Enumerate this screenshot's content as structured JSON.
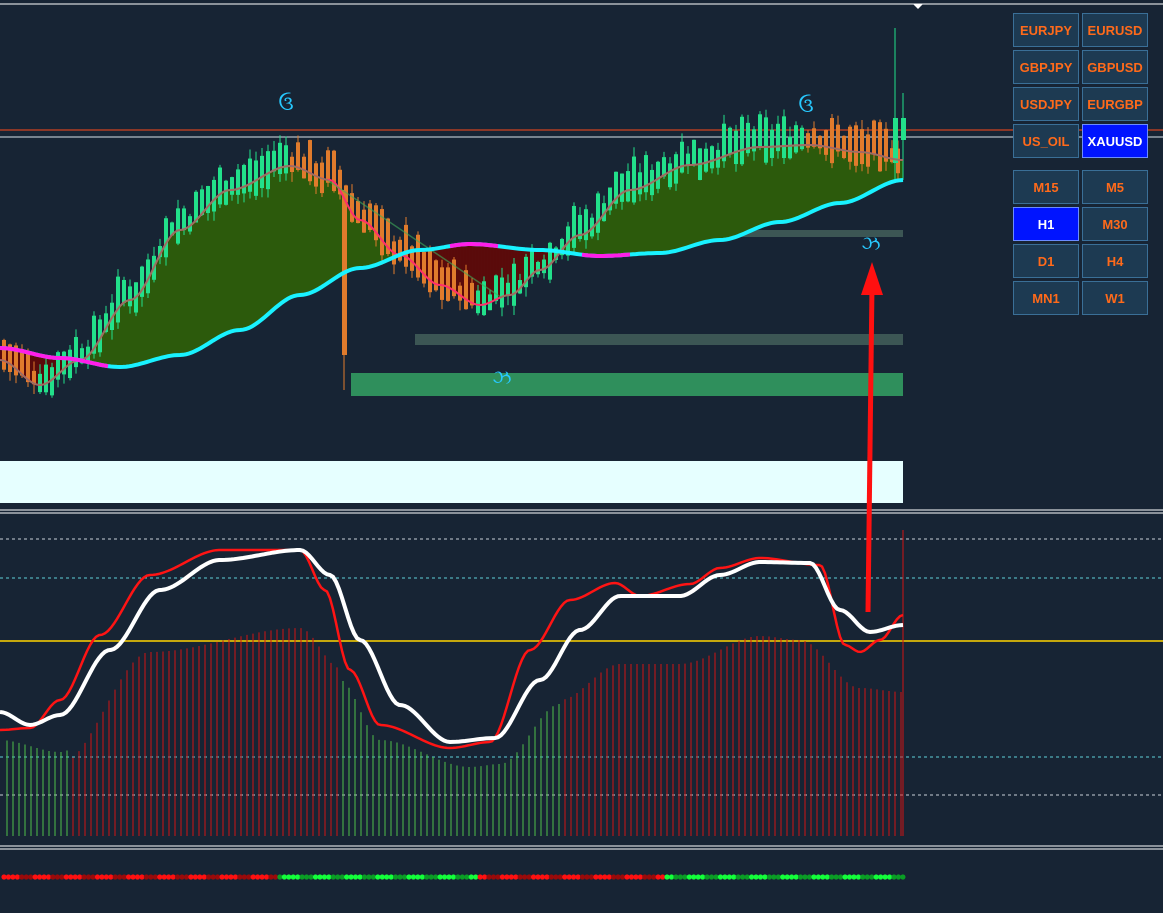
{
  "symbols": [
    "EURJPY",
    "EURUSD",
    "GBPJPY",
    "GBPUSD",
    "USDJPY",
    "EURGBP",
    "US_OIL",
    "XAUUSD"
  ],
  "active_symbol": "XAUUSD",
  "timeframes": [
    "M15",
    "M5",
    "H1",
    "M30",
    "D1",
    "H4",
    "MN1",
    "W1"
  ],
  "active_timeframe": "H1",
  "markers": {
    "upper": "ઉ",
    "lower": "ઝ"
  },
  "colors": {
    "background": "#172434",
    "bull_candle": "#22e08a",
    "bear_candle": "#e07b2c",
    "fast_ma": "#ff2f6a",
    "slow_ma_up": "#19f2ff",
    "slow_ma_down": "#ff1ee8",
    "cloud_bull": "#2c5a0c",
    "cloud_bear": "#5a0b0b",
    "osc_main": "#ffffff",
    "osc_signal": "#ff1414",
    "zero_line": "#ffd400",
    "arrow": "#ff1010"
  },
  "indicator": {
    "levels": [
      "80",
      "70",
      "50",
      "30",
      "20"
    ],
    "signal_dots": "rrrrrrrrrrrrrrrrrrrrrrrrrrrrrrrrrrrrrrrrrrrrrrrrrrrrrrrrrrrrrrgggggggggggggggggggggggggggggggggggggggggggggrrrrrrrrrrrrrrrrrrrrrrrrrrrrrrrrrrrrrrrrrrgggggggggggggggggggggggggggggggggggggggggggggggggggggggggggrrrrrrrrrrrrrrrrrrgg"
  }
}
